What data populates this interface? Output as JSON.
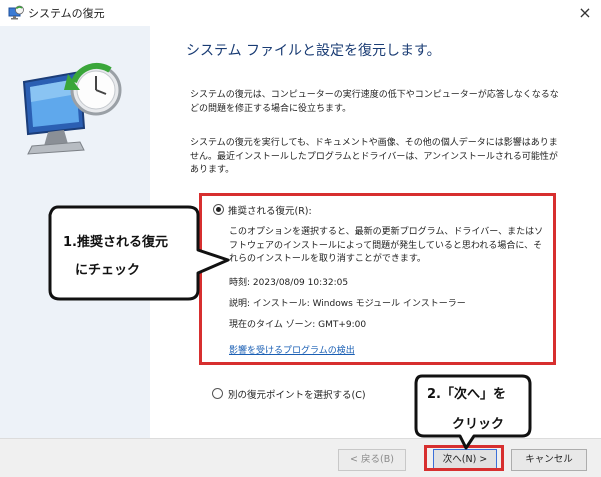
{
  "window": {
    "title": "システムの復元",
    "close_glyph": "×"
  },
  "content": {
    "heading": "システム ファイルと設定を復元します。",
    "paragraph1": "システムの復元は、コンピューターの実行速度の低下やコンピューターが応答しなくなるなどの問題を修正する場合に役立ちます。",
    "paragraph2": "システムの復元を実行しても、ドキュメントや画像、その他の個人データには影響はありません。最近インストールしたプログラムとドライバーは、アンインストールされる可能性があります。"
  },
  "recommended": {
    "label": "推奨される復元(R):",
    "selected": true,
    "description": "このオプションを選択すると、最新の更新プログラム、ドライバー、またはソフトウェアのインストールによって問題が発生していると思われる場合に、それらのインストールを取り消すことができます。",
    "time": "時刻: 2023/08/09 10:32:05",
    "desc": "説明: インストール: Windows モジュール インストーラー",
    "timezone": "現在のタイム ゾーン: GMT+9:00",
    "affected_link": "影響を受けるプログラムの検出"
  },
  "other_point": {
    "label": "別の復元ポイントを選択する(C)",
    "selected": false
  },
  "buttons": {
    "back": "< 戻る(B)",
    "next": "次へ(N) >",
    "cancel": "キャンセル"
  },
  "annotations": {
    "callout1_line1": "1.推奨される復元",
    "callout1_line2": "にチェック",
    "callout2_line1": "2.「次へ」を",
    "callout2_line2": "クリック"
  },
  "colors": {
    "highlight_red": "#d72f2f",
    "heading_blue": "#1a3c74",
    "link_blue": "#1a5fb4",
    "left_panel": "#edf2f8"
  },
  "icons": {
    "title": "system-restore-icon",
    "hero": "system-restore-monitor-clock-icon"
  }
}
